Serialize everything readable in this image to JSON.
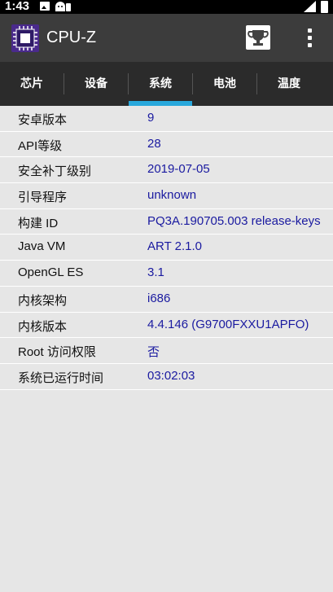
{
  "status_bar": {
    "time": "1:43",
    "icons": [
      "image-icon",
      "android-icon",
      "signal-icon",
      "battery-icon"
    ]
  },
  "app_bar": {
    "title": "CPU-Z",
    "logo_icon": "cpu-chip-icon",
    "action_icons": [
      "trophy-icon",
      "more-vertical-icon"
    ]
  },
  "tabs": [
    {
      "label": "芯片"
    },
    {
      "label": "设备"
    },
    {
      "label": "系统",
      "active": true
    },
    {
      "label": "电池"
    },
    {
      "label": "温度"
    }
  ],
  "system_info": [
    {
      "label": "安卓版本",
      "value": "9"
    },
    {
      "label": "API等级",
      "value": "28"
    },
    {
      "label": "安全补丁级别",
      "value": "2019-07-05"
    },
    {
      "label": "引导程序",
      "value": "unknown"
    },
    {
      "label": "构建 ID",
      "value": "PQ3A.190705.003 release-keys"
    },
    {
      "label": "Java VM",
      "value": "ART 2.1.0"
    },
    {
      "label": "OpenGL ES",
      "value": "3.1"
    },
    {
      "label": "内核架构",
      "value": "i686"
    },
    {
      "label": "内核版本",
      "value": "4.4.146 (G9700FXXU1APFO)"
    },
    {
      "label": "Root 访问权限",
      "value": "否"
    },
    {
      "label": "系统已运行时间",
      "value": "03:02:03"
    }
  ],
  "colors": {
    "accent": "#29a8dc",
    "value_text": "#1a1aa0",
    "app_bar": "#3c3c3c",
    "tab_bar": "#2b2b2b",
    "background": "#e6e6e6"
  }
}
